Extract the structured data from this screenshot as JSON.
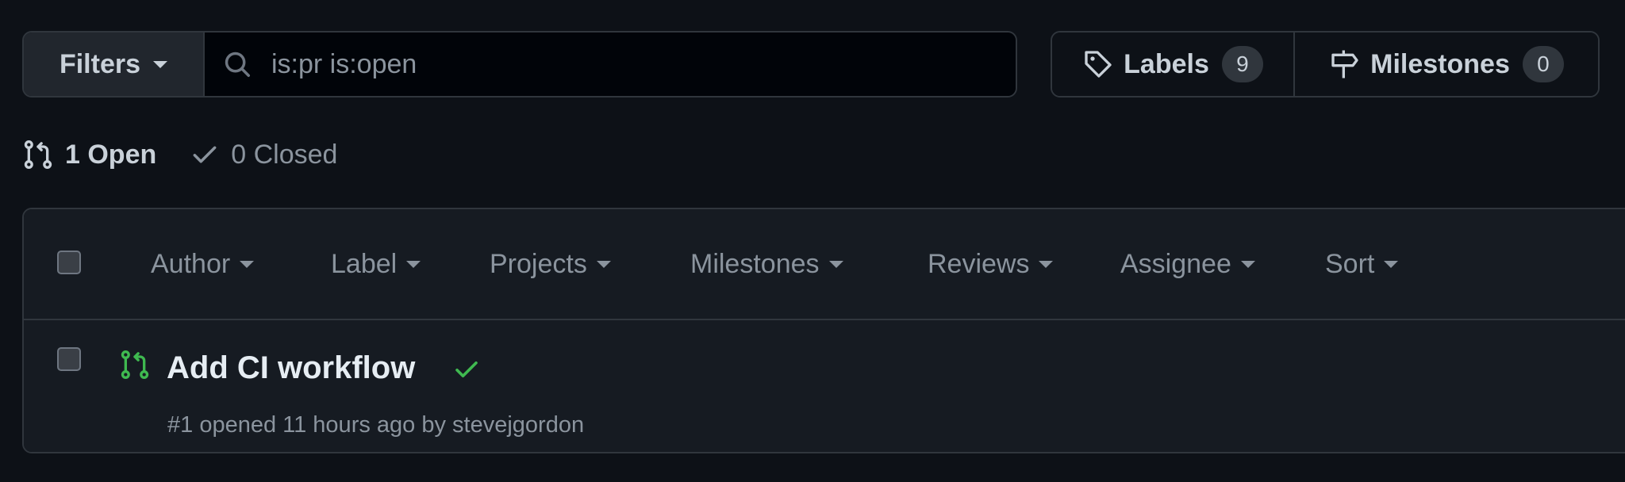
{
  "search_bar": {
    "filters_label": "Filters",
    "query": "is:pr is:open"
  },
  "labels_button": {
    "label": "Labels",
    "count": "9"
  },
  "milestones_button": {
    "label": "Milestones",
    "count": "0"
  },
  "states": {
    "open_label": "1 Open",
    "closed_label": "0 Closed"
  },
  "header_filters": [
    "Author",
    "Label",
    "Projects",
    "Milestones",
    "Reviews",
    "Assignee",
    "Sort"
  ],
  "pull_requests": [
    {
      "title": "Add CI workflow",
      "meta": "#1 opened 11 hours ago by stevejgordon",
      "status": "success"
    }
  ],
  "colors": {
    "background": "#0d1117",
    "open_green": "#3fb950",
    "muted_text": "#8b949e",
    "border": "#30363d"
  }
}
